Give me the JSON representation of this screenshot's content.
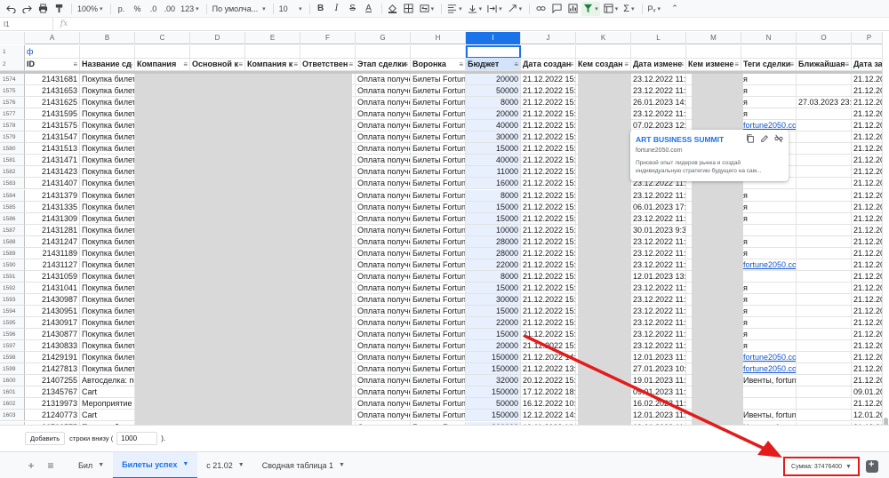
{
  "toolbar": {
    "zoom": "100%",
    "currency": "р.",
    "percent": "%",
    "dec_less": ".0",
    "dec_more": ".00",
    "more_formats": "123",
    "font": "По умолча...",
    "font_size": "10",
    "bold": "B",
    "italic": "I",
    "strike": "S",
    "text_color": "A",
    "input_tools": "Рᵥ"
  },
  "formula_bar": {
    "name_box": "I1",
    "fx": "fx",
    "value": ""
  },
  "columns": [
    "A",
    "B",
    "C",
    "D",
    "E",
    "F",
    "G",
    "H",
    "I",
    "J",
    "K",
    "L",
    "M",
    "N",
    "O",
    "P"
  ],
  "selected_column": "I",
  "row1": {
    "number": "1",
    "a_value": "ф"
  },
  "header_row": {
    "number": "2",
    "cells": [
      "ID",
      "Название сд",
      "Компания",
      "Основной к",
      "Компания к",
      "Ответствен",
      "Этап сделки",
      "Воронка",
      "Бюджет",
      "Дата создан",
      "Кем создан",
      "Дата измене",
      "Кем измене",
      "Теги сделки",
      "Ближайшая",
      "Дата за"
    ]
  },
  "rows": [
    {
      "n": "1574",
      "id": "21431681",
      "name": "Покупка билета",
      "stage": "Оплата получена",
      "funnel": "Билеты Fortune",
      "budget": "20000",
      "created": "21.12.2022 15:4",
      "modified": "23.12.2022 11:52",
      "tags": "я",
      "next": "",
      "last": "21.12.20"
    },
    {
      "n": "1575",
      "id": "21431653",
      "name": "Покупка билета",
      "stage": "Оплата получена",
      "funnel": "Билеты Fortune",
      "budget": "50000",
      "created": "21.12.2022 15:4",
      "modified": "23.12.2022 11:52",
      "tags": "я",
      "next": "",
      "last": "21.12.20"
    },
    {
      "n": "1576",
      "id": "21431625",
      "name": "Покупка билета",
      "stage": "Оплата получена",
      "funnel": "Билеты Fortune",
      "budget": "8000",
      "created": "21.12.2022 15:4",
      "modified": "26.01.2023 14:50",
      "tags": "я",
      "next": "27.03.2023 23:59",
      "last": "21.12.20"
    },
    {
      "n": "1577",
      "id": "21431595",
      "name": "Покупка билета",
      "stage": "Оплата получена",
      "funnel": "Билеты Fortune",
      "budget": "20000",
      "created": "21.12.2022 15:4",
      "modified": "23.12.2022 11:52",
      "tags": "я",
      "next": "",
      "last": "21.12.20"
    },
    {
      "n": "1578",
      "id": "21431575",
      "name": "Покупка билета",
      "stage": "Оплата получена",
      "funnel": "Билеты Fortune",
      "budget": "40000",
      "created": "21.12.2022 15:4",
      "modified": "07.02.2023 12:3",
      "tags": "fortune2050.com",
      "next": "",
      "last": "21.12.20"
    },
    {
      "n": "1579",
      "id": "21431547",
      "name": "Покупка билета",
      "stage": "Оплата получена",
      "funnel": "Билеты Fortune",
      "budget": "30000",
      "created": "21.12.2022 15:4",
      "modified": "23.12.2022 11:52",
      "tags": "com",
      "next": "",
      "last": "21.12.20"
    },
    {
      "n": "1580",
      "id": "21431513",
      "name": "Покупка билета",
      "stage": "Оплата получена",
      "funnel": "Билеты Fortune",
      "budget": "15000",
      "created": "21.12.2022 15:3",
      "modified": "23.12.2022 11:52",
      "tags": "com",
      "next": "",
      "last": "21.12.20"
    },
    {
      "n": "1581",
      "id": "21431471",
      "name": "Покупка билета",
      "stage": "Оплата получена",
      "funnel": "Билеты Fortune",
      "budget": "40000",
      "created": "21.12.2022 15:3",
      "modified": "23.12.2022 11:52",
      "tags": "",
      "next": "",
      "last": "21.12.20"
    },
    {
      "n": "1582",
      "id": "21431423",
      "name": "Покупка билета",
      "stage": "Оплата получена",
      "funnel": "Билеты Fortune",
      "budget": "11000",
      "created": "21.12.2022 15:3",
      "modified": "23.12.2022 11:52",
      "tags": "",
      "next": "",
      "last": "21.12.20"
    },
    {
      "n": "1583",
      "id": "21431407",
      "name": "Покупка билета",
      "stage": "Оплата получена",
      "funnel": "Билеты Fortune",
      "budget": "16000",
      "created": "21.12.2022 15:3",
      "modified": "23.12.2022 11:52",
      "tags": "",
      "next": "",
      "last": "21.12.20"
    },
    {
      "n": "1584",
      "id": "21431379",
      "name": "Покупка билета",
      "stage": "Оплата получена",
      "funnel": "Билеты Fortune",
      "budget": "8000",
      "created": "21.12.2022 15:3",
      "modified": "23.12.2022 11:52",
      "tags": "я",
      "next": "",
      "last": "21.12.20"
    },
    {
      "n": "1585",
      "id": "21431335",
      "name": "Покупка билета",
      "stage": "Оплата получена",
      "funnel": "Билеты Fortune",
      "budget": "15000",
      "created": "21.12.2022 15:3",
      "modified": "06.01.2023 17:4",
      "tags": "я",
      "next": "",
      "last": "21.12.20"
    },
    {
      "n": "1586",
      "id": "21431309",
      "name": "Покупка билета",
      "stage": "Оплата получена",
      "funnel": "Билеты Fortune",
      "budget": "15000",
      "created": "21.12.2022 15:3",
      "modified": "23.12.2022 11:52",
      "tags": "я",
      "next": "",
      "last": "21.12.20"
    },
    {
      "n": "1587",
      "id": "21431281",
      "name": "Покупка билета",
      "stage": "Оплата получена",
      "funnel": "Билеты Fortune",
      "budget": "10000",
      "created": "21.12.2022 15:3",
      "modified": "30.01.2023 9:32",
      "tags": "",
      "next": "",
      "last": "21.12.20"
    },
    {
      "n": "1588",
      "id": "21431247",
      "name": "Покупка билета",
      "stage": "Оплата получена",
      "funnel": "Билеты Fortune",
      "budget": "28000",
      "created": "21.12.2022 15:2",
      "modified": "23.12.2022 11:52",
      "tags": "я",
      "next": "",
      "last": "21.12.20"
    },
    {
      "n": "1589",
      "id": "21431189",
      "name": "Покупка билета",
      "stage": "Оплата получена",
      "funnel": "Билеты Fortune",
      "budget": "28000",
      "created": "21.12.2022 15:2",
      "modified": "23.12.2022 11:52",
      "tags": "я",
      "next": "",
      "last": "21.12.20"
    },
    {
      "n": "1590",
      "id": "21431127",
      "name": "Покупка билета",
      "stage": "Оплата получена",
      "funnel": "Билеты Fortune",
      "budget": "22000",
      "created": "21.12.2022 15:2",
      "modified": "23.12.2022 11:52",
      "tags": "fortune2050.com",
      "next": "",
      "last": "21.12.20"
    },
    {
      "n": "1591",
      "id": "21431059",
      "name": "Покупка билета",
      "stage": "Оплата получена",
      "funnel": "Билеты Fortune",
      "budget": "8000",
      "created": "21.12.2022 15:2",
      "modified": "12.01.2023 13:16",
      "tags": "",
      "next": "",
      "last": "21.12.20"
    },
    {
      "n": "1592",
      "id": "21431041",
      "name": "Покупка билета",
      "stage": "Оплата получена",
      "funnel": "Билеты Fortune",
      "budget": "15000",
      "created": "21.12.2022 15:2",
      "modified": "23.12.2022 11:52",
      "tags": "я",
      "next": "",
      "last": "21.12.20"
    },
    {
      "n": "1593",
      "id": "21430987",
      "name": "Покупка билета",
      "stage": "Оплата получена",
      "funnel": "Билеты Fortune",
      "budget": "30000",
      "created": "21.12.2022 15:2",
      "modified": "23.12.2022 11:52",
      "tags": "я",
      "next": "",
      "last": "21.12.20"
    },
    {
      "n": "1594",
      "id": "21430951",
      "name": "Покупка билета",
      "stage": "Оплата получена",
      "funnel": "Билеты Fortune",
      "budget": "15000",
      "created": "21.12.2022 15:1",
      "modified": "23.12.2022 11:52",
      "tags": "я",
      "next": "",
      "last": "21.12.20"
    },
    {
      "n": "1595",
      "id": "21430917",
      "name": "Покупка билета",
      "stage": "Оплата получена",
      "funnel": "Билеты Fortune",
      "budget": "22000",
      "created": "21.12.2022 15:1",
      "modified": "23.12.2022 11:52",
      "tags": "я",
      "next": "",
      "last": "21.12.20"
    },
    {
      "n": "1596",
      "id": "21430877",
      "name": "Покупка билета",
      "stage": "Оплата получена",
      "funnel": "Билеты Fortune",
      "budget": "15000",
      "created": "21.12.2022 15:1",
      "modified": "23.12.2022 11:52",
      "tags": "я",
      "next": "",
      "last": "21.12.20"
    },
    {
      "n": "1597",
      "id": "21430833",
      "name": "Покупка билета",
      "stage": "Оплата получена",
      "funnel": "Билеты Fortune",
      "budget": "20000",
      "created": "21.12.2022 15:1",
      "modified": "23.12.2022 11:52",
      "tags": "я",
      "next": "",
      "last": "21.12.20"
    },
    {
      "n": "1598",
      "id": "21429191",
      "name": "Покупка билета",
      "stage": "Оплата получена",
      "funnel": "Билеты Fortune",
      "budget": "150000",
      "created": "21.12.2022 14:2",
      "modified": "12.01.2023 11:47",
      "tags": "fortune2050.com",
      "next": "",
      "last": "21.12.20"
    },
    {
      "n": "1599",
      "id": "21427813",
      "name": "Покупка билета",
      "stage": "Оплата получена",
      "funnel": "Билеты Fortune",
      "budget": "150000",
      "created": "21.12.2022 13:4",
      "modified": "27.01.2023 10:3",
      "tags": "fortune2050.com",
      "next": "",
      "last": "21.12.20"
    },
    {
      "n": "1600",
      "id": "21407255",
      "name": "Автосделка: по",
      "stage": "Оплата получена",
      "funnel": "Билеты Fortune",
      "budget": "32000",
      "created": "20.12.2022 15:2",
      "modified": "19.01.2023 11:04",
      "tags": "Ивенты, fortune2050.com",
      "next": "",
      "last": "21.12.20"
    },
    {
      "n": "1601",
      "id": "21345767",
      "name": "Cart",
      "stage": "Оплата получена",
      "funnel": "Билеты Fortune",
      "budget": "150000",
      "created": "17.12.2022 18:5",
      "modified": "09.01.2023 11:04",
      "tags": "",
      "next": "",
      "last": "09.01.20"
    },
    {
      "n": "1602",
      "id": "21319973",
      "name": "Мероприятие 4",
      "stage": "Оплата получена",
      "funnel": "Билеты Fortune",
      "budget": "50000",
      "created": "16.12.2022 10:0",
      "modified": "16.02.2023 11:0",
      "tags": "",
      "next": "",
      "last": "21.12.20"
    },
    {
      "n": "1603",
      "id": "21240773",
      "name": "Cart",
      "stage": "Оплата получена",
      "funnel": "Билеты Fortune",
      "budget": "150000",
      "created": "12.12.2022 14:5",
      "modified": "12.01.2023 11:04",
      "tags": "Ивенты, fortune2050.com",
      "next": "",
      "last": "12.01.20"
    },
    {
      "n": "1604",
      "id": "20702575",
      "name": "Покупка билета",
      "stage": "Оплата получена",
      "funnel": "Билеты Fortune",
      "budget": "300000",
      "created": "19.11.2022 16:3",
      "modified": "19.01.2023 11:04",
      "tags": "Ивенты, fortune2050.com, fortune",
      "next": "",
      "last": "21.12.20"
    }
  ],
  "tooltip": {
    "title": "ART BUSINESS SUMMIT",
    "url": "fortune2050.com",
    "description": "Присвой опыт лидеров рынка и создай индивидуальную стратегию будущего на сам..."
  },
  "add_rows": {
    "button": "Добавить",
    "text": "строки внизу (",
    "count": "1000",
    "suffix": ")."
  },
  "sheets": {
    "add": "+",
    "list": "≡",
    "tabs": [
      {
        "label": "Бил",
        "active": false
      },
      {
        "label": "Билеты успех",
        "active": true
      },
      {
        "label": "с 21.02",
        "active": false
      },
      {
        "label": "Сводная таблица 1",
        "active": false
      }
    ]
  },
  "sum": "Сумма: 37476400",
  "colors": {
    "accent": "#1a73e8",
    "annotation_red": "#e21b1b",
    "selection": "#e8f0fe"
  }
}
